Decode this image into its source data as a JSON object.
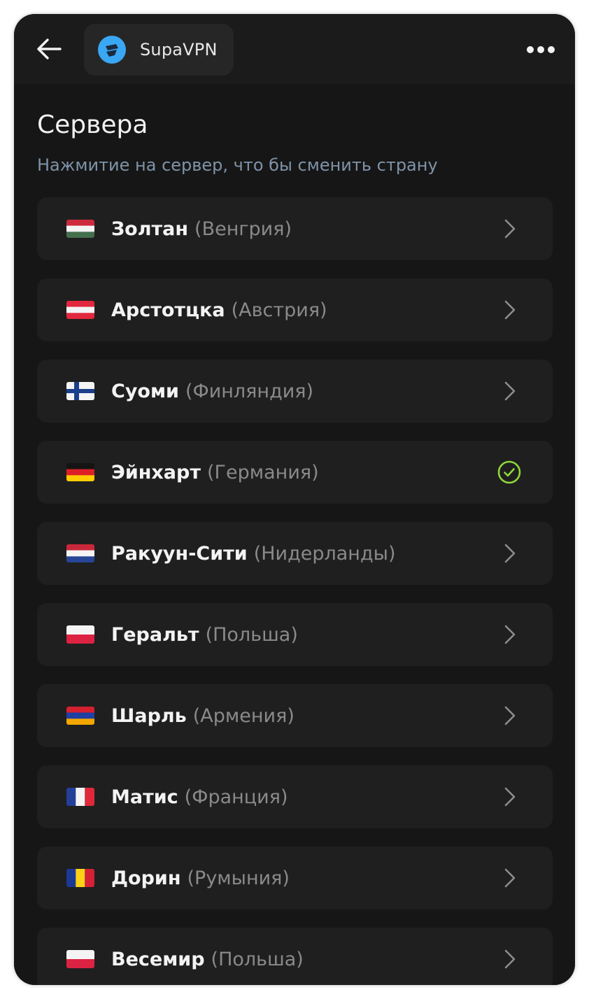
{
  "header": {
    "app_name": "SupaVPN",
    "back_icon": "arrow-left-icon",
    "more_icon": "more-horizontal-icon",
    "logo_icon": "supavpn-logo-icon"
  },
  "page": {
    "title": "Сервера",
    "subtitle": "Нажмитие на сервер, что бы сменить страну"
  },
  "colors": {
    "background": "#161616",
    "card": "#1f1f1f",
    "subtitle": "#7f93a8",
    "selected_check": "#8fd63b",
    "logo_blue": "#3aa7f5"
  },
  "servers": [
    {
      "name": "Золтан",
      "country": "(Венгрия)",
      "flag": "hungary",
      "selected": false
    },
    {
      "name": "Арстотцка",
      "country": "(Австрия)",
      "flag": "austria",
      "selected": false
    },
    {
      "name": "Суоми",
      "country": "(Финляндия)",
      "flag": "finland",
      "selected": false
    },
    {
      "name": "Эйнхарт",
      "country": "(Германия)",
      "flag": "germany",
      "selected": true
    },
    {
      "name": "Ракуун-Сити",
      "country": "(Нидерланды)",
      "flag": "netherlands",
      "selected": false
    },
    {
      "name": "Геральт",
      "country": "(Польша)",
      "flag": "poland",
      "selected": false
    },
    {
      "name": "Шарль",
      "country": "(Армения)",
      "flag": "armenia",
      "selected": false
    },
    {
      "name": "Матис",
      "country": "(Франция)",
      "flag": "france",
      "selected": false
    },
    {
      "name": "Дорин",
      "country": "(Румыния)",
      "flag": "romania",
      "selected": false
    },
    {
      "name": "Весемир",
      "country": "(Польша)",
      "flag": "poland",
      "selected": false
    }
  ]
}
